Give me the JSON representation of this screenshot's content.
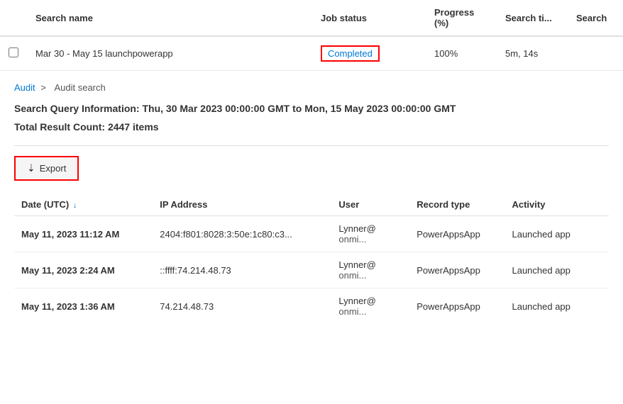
{
  "topTable": {
    "columns": {
      "searchName": "Search name",
      "jobStatus": "Job status",
      "progress": "Progress (%)",
      "searchTime": "Search ti...",
      "searchAction": "Search"
    },
    "row": {
      "name": "Mar 30 - May 15 launchpowerapp",
      "status": "Completed",
      "progress": "100%",
      "time": "5m, 14s"
    }
  },
  "breadcrumb": {
    "audit": "Audit",
    "separator": ">",
    "auditSearch": "Audit search"
  },
  "queryInfo": "Search Query Information: Thu, 30 Mar 2023 00:00:00 GMT to Mon, 15 May 2023 00:00:00 GMT",
  "resultCount": "Total Result Count: 2447 items",
  "exportButton": "Export",
  "resultsTable": {
    "columns": {
      "date": "Date (UTC)",
      "ip": "IP Address",
      "user": "User",
      "recordType": "Record type",
      "activity": "Activity"
    },
    "rows": [
      {
        "date": "May 11, 2023 11:12 AM",
        "ip": "2404:f801:8028:3:50e:1c80:c3...",
        "user": "Lynner@",
        "org": "onmi...",
        "recordType": "PowerAppsApp",
        "activity": "Launched app"
      },
      {
        "date": "May 11, 2023 2:24 AM",
        "ip": "::ffff:74.214.48.73",
        "user": "Lynner@",
        "org": "onmi...",
        "recordType": "PowerAppsApp",
        "activity": "Launched app"
      },
      {
        "date": "May 11, 2023 1:36 AM",
        "ip": "74.214.48.73",
        "user": "Lynner@",
        "org": "onmi...",
        "recordType": "PowerAppsApp",
        "activity": "Launched app"
      }
    ]
  }
}
